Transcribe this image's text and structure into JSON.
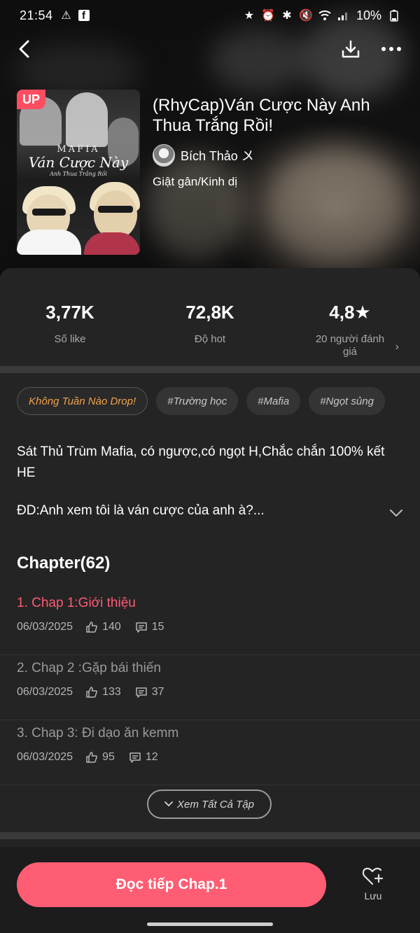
{
  "status_bar": {
    "time": "21:54",
    "battery": "10%"
  },
  "book": {
    "badge": "UP",
    "cover": {
      "line1": "MAFIA",
      "line2": "Ván Cược Này",
      "line3": "Anh Thua Trắng Rồi"
    },
    "title": "(RhyCap)Ván Cược Này Anh Thua Trắng Rồi!",
    "author": "Bích Thảo 〤",
    "genre": "Giật gân/Kinh dị"
  },
  "stats": {
    "likes": {
      "value": "3,77K",
      "label": "Số like"
    },
    "hot": {
      "value": "72,8K",
      "label": "Độ hot"
    },
    "rating": {
      "value": "4,8",
      "label": "20 người đánh giá"
    }
  },
  "tags": [
    "Không Tuần Nào Drop!",
    "#Trường học",
    "#Mafia",
    "#Ngọt sủng"
  ],
  "description": "Sát Thủ Trùm Mafia, có ngược,có ngọt H,Chắc chắn 100% kết HE",
  "quote": "ĐD:Anh xem tôi là ván cược của anh à?...",
  "chapters_header": "Chapter(62)",
  "chapters": [
    {
      "title": "1. Chap 1:Giới thiệu",
      "date": "06/03/2025",
      "likes": "140",
      "comments": "15"
    },
    {
      "title": "2. Chap 2 :Gặp bái thiến",
      "date": "06/03/2025",
      "likes": "133",
      "comments": "37"
    },
    {
      "title": "3. Chap 3: Đi dạo ăn kemm",
      "date": "06/03/2025",
      "likes": "95",
      "comments": "12"
    }
  ],
  "see_all": "Xem Tất Cả Tập",
  "bottom": {
    "read_button": "Đọc tiếp Chap.1",
    "save_label": "Lưu"
  },
  "colors": {
    "accent": "#ff5d73",
    "badge": "#ff4d62",
    "star": "#ffb400",
    "tag_highlight": "#f0a24a",
    "background": "#242424"
  }
}
